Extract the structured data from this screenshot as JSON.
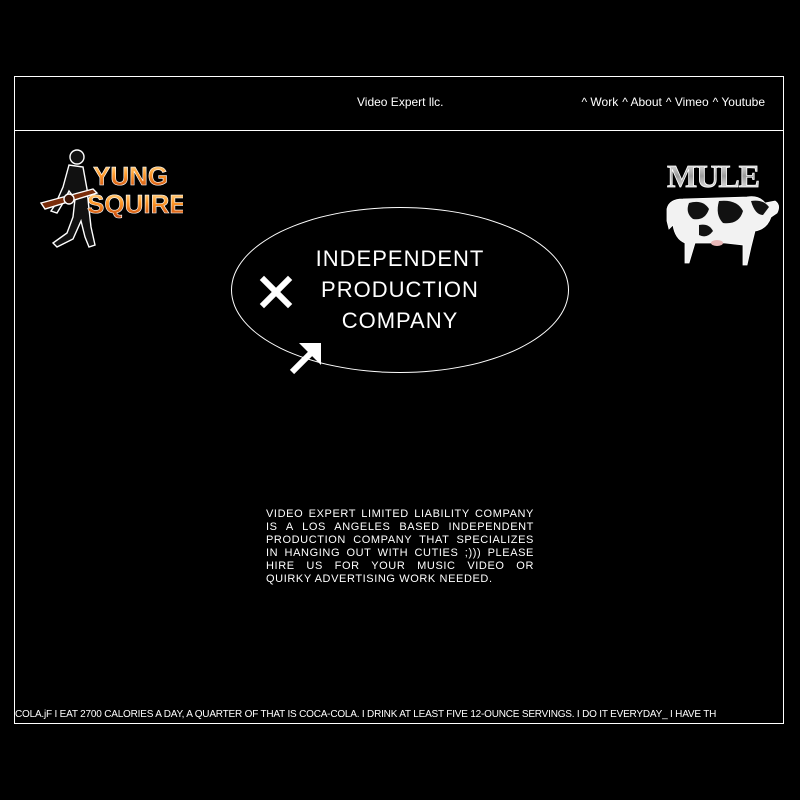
{
  "header": {
    "brand": "Video Expert llc.",
    "nav": [
      {
        "label": "^ Work"
      },
      {
        "label": "^ About"
      },
      {
        "label": "^ Vimeo"
      },
      {
        "label": "^ Youtube"
      }
    ]
  },
  "logos": {
    "left": {
      "line1": "YUNG",
      "line2": "SQUIRE"
    },
    "right": {
      "text": "MULE"
    }
  },
  "hero": {
    "line1": "INDEPENDENT",
    "line2": "PRODUCTION",
    "line3": "COMPANY",
    "close_icon": "close-icon",
    "arrow_icon": "arrow-up-right-icon"
  },
  "description": "VIDEO EXPERT LIMITED LIABILITY COMPANY IS A LOS ANGELES BASED INDEPENDENT PRODUCTION COMPANY THAT SPECIALIZES IN HANGING OUT WITH CUTIES ;))) PLEASE HIRE US FOR YOUR MUSIC VIDEO OR QUIRKY ADVERTISING WORK NEEDED.",
  "ticker": "COLA.jF I EAT 2700 CALORIES A DAY, A QUARTER OF THAT IS COCA-COLA. I DRINK AT LEAST FIVE 12-OUNCE SERVINGS. I DO IT EVERYDAY_ I HAVE TH",
  "colors": {
    "background": "#000000",
    "foreground": "#ffffff",
    "fire": "#ff8a1f"
  }
}
